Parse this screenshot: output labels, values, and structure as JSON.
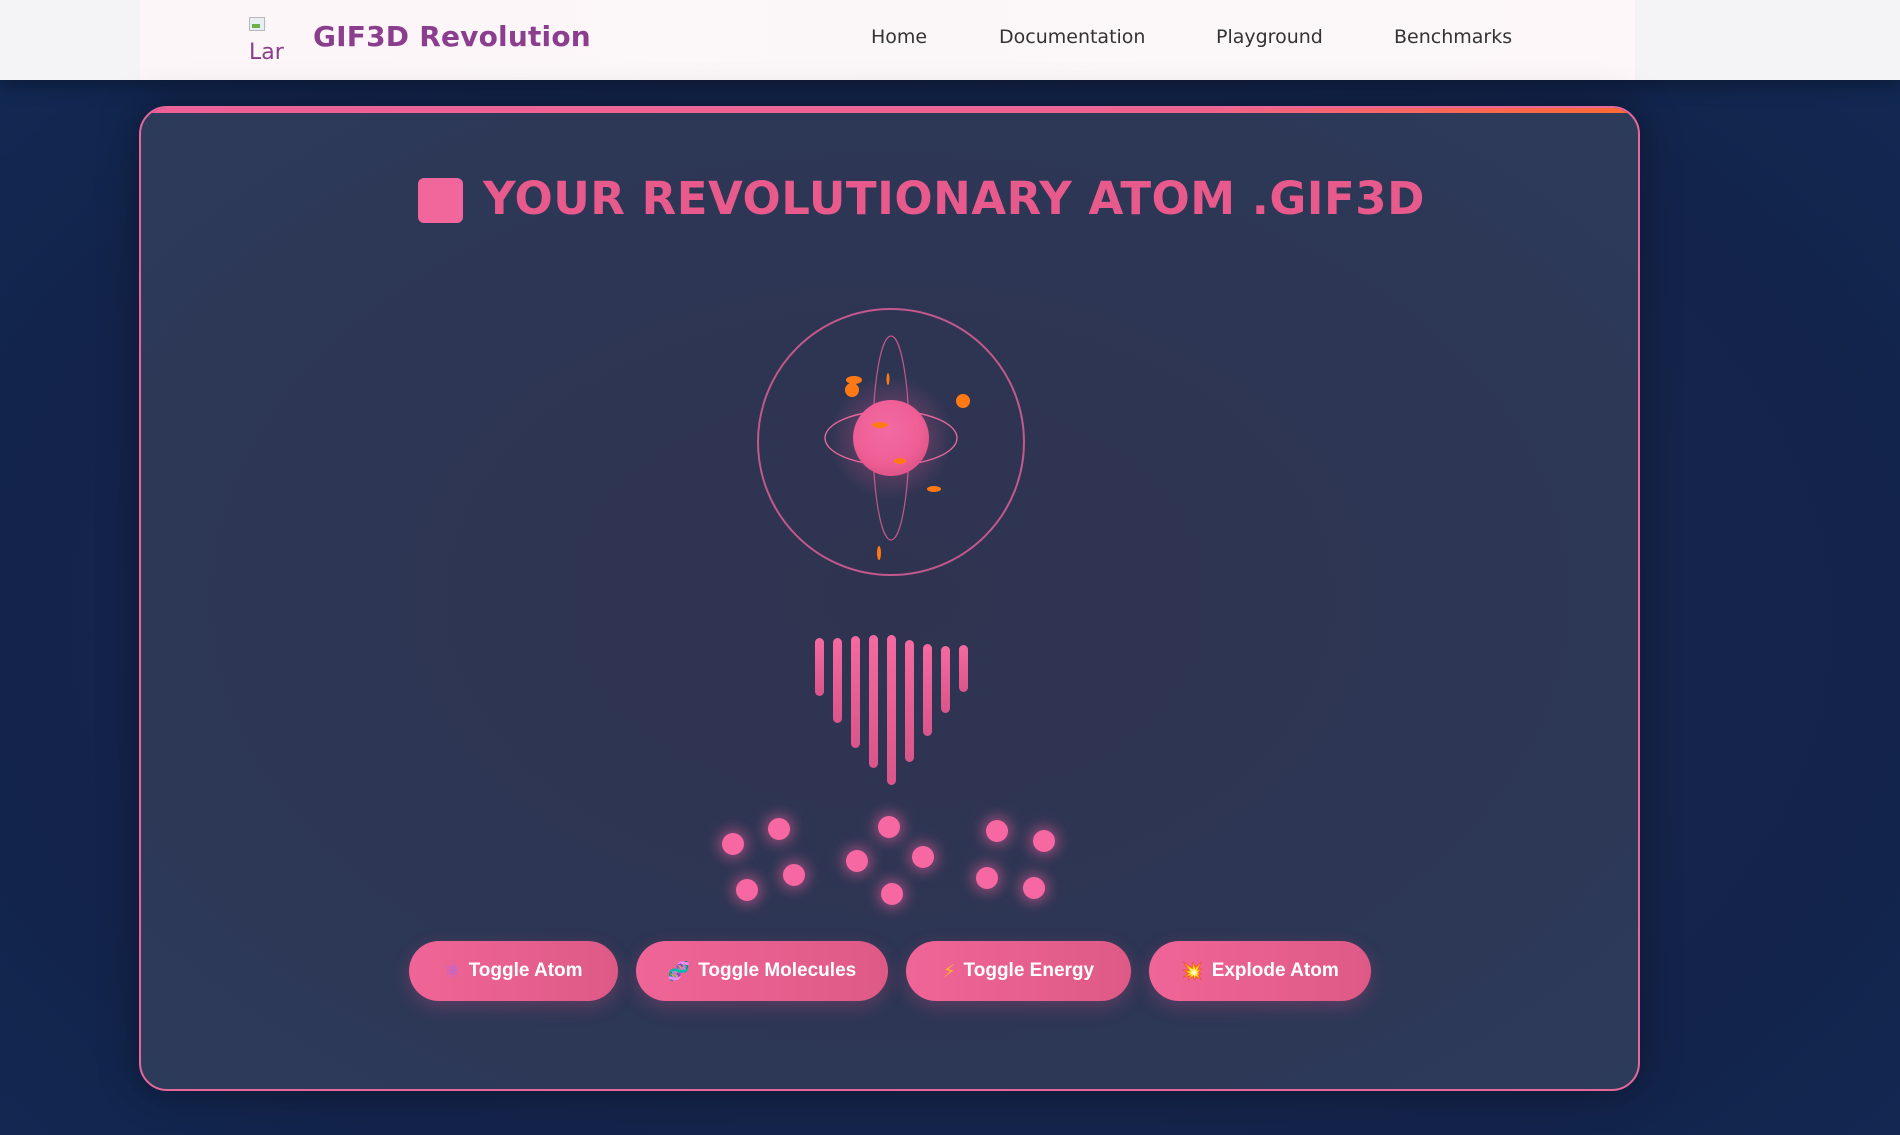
{
  "header": {
    "logo_alt": "Lar",
    "brand": "GIF3D Revolution",
    "nav": [
      "Home",
      "Documentation",
      "Playground",
      "Benchmarks"
    ]
  },
  "main": {
    "title": "YOUR REVOLUTIONARY ATOM .GIF3D",
    "buttons": [
      {
        "icon": "⚛",
        "label": "Toggle Atom"
      },
      {
        "icon": "🧬",
        "label": "Toggle Molecules"
      },
      {
        "icon": "⚡",
        "label": "Toggle Energy"
      },
      {
        "icon": "💥",
        "label": "Explode Atom"
      }
    ]
  },
  "colors": {
    "accent": "#f06597",
    "brand": "#8b3e8e",
    "electron": "#ff7a14",
    "card_border": "#e6679a"
  }
}
